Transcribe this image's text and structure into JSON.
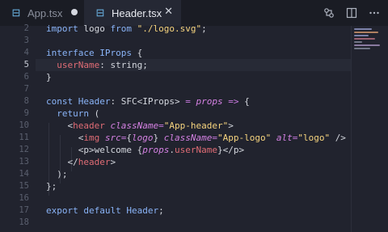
{
  "tabs": [
    {
      "label": "App.tsx",
      "state": "modified"
    },
    {
      "label": "Header.tsx",
      "state": "active"
    }
  ],
  "toolbar": {
    "split_label": "split-editor",
    "open_changes_label": "open-changes"
  },
  "lines": [
    {
      "n": "2",
      "tokens": [
        [
          "kw",
          "import "
        ],
        [
          "plain",
          "logo "
        ],
        [
          "kw",
          "from "
        ],
        [
          "str",
          "\"./logo.svg\""
        ],
        [
          "plain",
          ";"
        ]
      ]
    },
    {
      "n": "3",
      "tokens": []
    },
    {
      "n": "4",
      "tokens": [
        [
          "kw",
          "interface "
        ],
        [
          "ty",
          "IProps "
        ],
        [
          "plain",
          "{"
        ]
      ]
    },
    {
      "n": "5",
      "tokens": [
        [
          "plain",
          "  "
        ],
        [
          "prop",
          "userName"
        ],
        [
          "plain",
          ": "
        ],
        [
          "plain",
          "string;"
        ]
      ]
    },
    {
      "n": "6",
      "tokens": [
        [
          "plain",
          "}"
        ]
      ]
    },
    {
      "n": "7",
      "tokens": []
    },
    {
      "n": "8",
      "tokens": [
        [
          "kw",
          "const "
        ],
        [
          "ty",
          "Header"
        ],
        [
          "plain",
          ": SFC<IProps> "
        ],
        [
          "op",
          "= "
        ],
        [
          "it",
          "props "
        ],
        [
          "op",
          "=> "
        ],
        [
          "plain",
          "{"
        ]
      ]
    },
    {
      "n": "9",
      "tokens": [
        [
          "plain",
          "  "
        ],
        [
          "kw",
          "return "
        ],
        [
          "plain",
          "("
        ]
      ]
    },
    {
      "n": "10",
      "tokens": [
        [
          "plain",
          "    <"
        ],
        [
          "tag",
          "header "
        ],
        [
          "attr",
          "className"
        ],
        [
          "op",
          "="
        ],
        [
          "str",
          "\"App-header\""
        ],
        [
          "plain",
          ">"
        ]
      ]
    },
    {
      "n": "11",
      "tokens": [
        [
          "plain",
          "      <"
        ],
        [
          "tag",
          "img "
        ],
        [
          "attr",
          "src"
        ],
        [
          "op",
          "="
        ],
        [
          "plain",
          "{"
        ],
        [
          "it",
          "logo"
        ],
        [
          "plain",
          "} "
        ],
        [
          "attr",
          "className"
        ],
        [
          "op",
          "="
        ],
        [
          "str",
          "\"App-logo\" "
        ],
        [
          "attr",
          "alt"
        ],
        [
          "op",
          "="
        ],
        [
          "str",
          "\"logo\" "
        ],
        [
          "plain",
          "/>"
        ]
      ]
    },
    {
      "n": "12",
      "tokens": [
        [
          "plain",
          "      <p>welcome {"
        ],
        [
          "it",
          "props"
        ],
        [
          "plain",
          "."
        ],
        [
          "prop",
          "userName"
        ],
        [
          "plain",
          "}</p>"
        ]
      ]
    },
    {
      "n": "13",
      "tokens": [
        [
          "plain",
          "    </"
        ],
        [
          "tag",
          "header"
        ],
        [
          "plain",
          ">"
        ]
      ]
    },
    {
      "n": "14",
      "tokens": [
        [
          "plain",
          "  );"
        ]
      ]
    },
    {
      "n": "15",
      "tokens": [
        [
          "plain",
          "};"
        ]
      ]
    },
    {
      "n": "16",
      "tokens": []
    },
    {
      "n": "17",
      "tokens": [
        [
          "kw",
          "export "
        ],
        [
          "kw",
          "default "
        ],
        [
          "ty",
          "Header"
        ],
        [
          "plain",
          ";"
        ]
      ]
    },
    {
      "n": "18",
      "tokens": []
    }
  ],
  "active_line": "5"
}
